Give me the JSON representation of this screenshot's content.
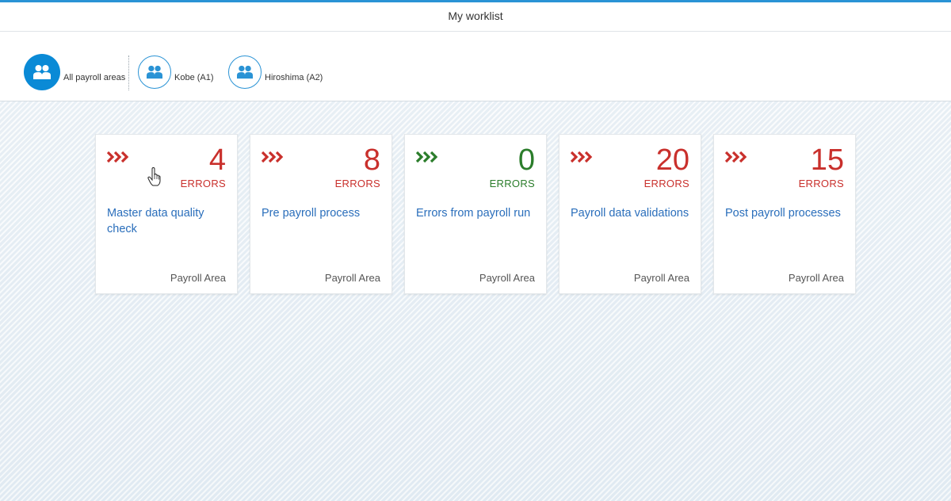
{
  "header": {
    "title": "My worklist"
  },
  "filters": [
    {
      "label": "All payroll areas",
      "icon": "people-icon",
      "selected": true
    },
    {
      "label": "Kobe (A1)",
      "icon": "people-icon",
      "selected": false
    },
    {
      "label": "Hiroshima (A2)",
      "icon": "people-icon",
      "selected": false
    }
  ],
  "tiles": [
    {
      "number": "4",
      "unit": "ERRORS",
      "title": "Master data quality check",
      "footer": "Payroll Area",
      "status": "error",
      "color": "#c9302c"
    },
    {
      "number": "8",
      "unit": "ERRORS",
      "title": "Pre payroll process",
      "footer": "Payroll Area",
      "status": "error",
      "color": "#c9302c"
    },
    {
      "number": "0",
      "unit": "ERRORS",
      "title": "Errors from payroll run",
      "footer": "Payroll Area",
      "status": "success",
      "color": "#2b7d2b"
    },
    {
      "number": "20",
      "unit": "ERRORS",
      "title": "Payroll data validations",
      "footer": "Payroll Area",
      "status": "error",
      "color": "#c9302c"
    },
    {
      "number": "15",
      "unit": "ERRORS",
      "title": "Post payroll processes",
      "footer": "Payroll Area",
      "status": "error",
      "color": "#c9302c"
    }
  ],
  "colors": {
    "accent": "#0a8ad6",
    "error": "#c9302c",
    "success": "#2b7d2b",
    "link": "#2a6ebb"
  }
}
